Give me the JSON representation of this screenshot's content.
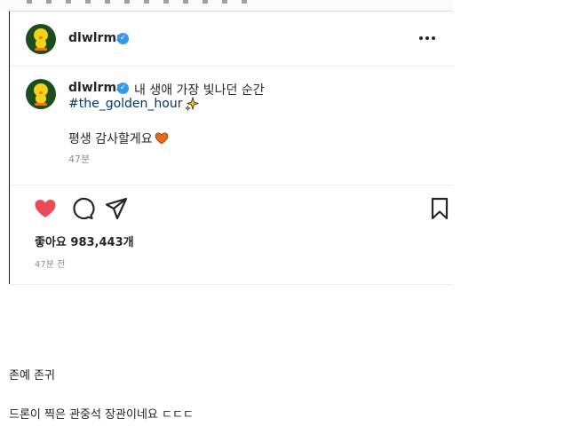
{
  "post": {
    "username": "dlwlrma",
    "caption": "내 생애 가장 빛나던 순간",
    "hashtag": "#the_golden_hour",
    "comment": "평생 감사할게요",
    "caption_time": "47분",
    "likes": "좋아요 983,443개",
    "post_time": "47분 전",
    "icons": {
      "more": "more-options-icon",
      "like": "heart-icon",
      "comment": "comment-icon",
      "share": "share-icon",
      "save": "bookmark-icon",
      "verified": "verified-badge-icon",
      "sparkle": "sparkles-emoji",
      "heart_emoji": "orange-heart-emoji"
    },
    "colors": {
      "like": "#ed4956",
      "verified": "#3797f0",
      "hashtag": "#00376b",
      "heart_emoji": "#e8671b"
    }
  },
  "page_comments": [
    "존예 존귀",
    "드론이 찍은 관중석 장관이네요 ㄷㄷㄷ"
  ]
}
